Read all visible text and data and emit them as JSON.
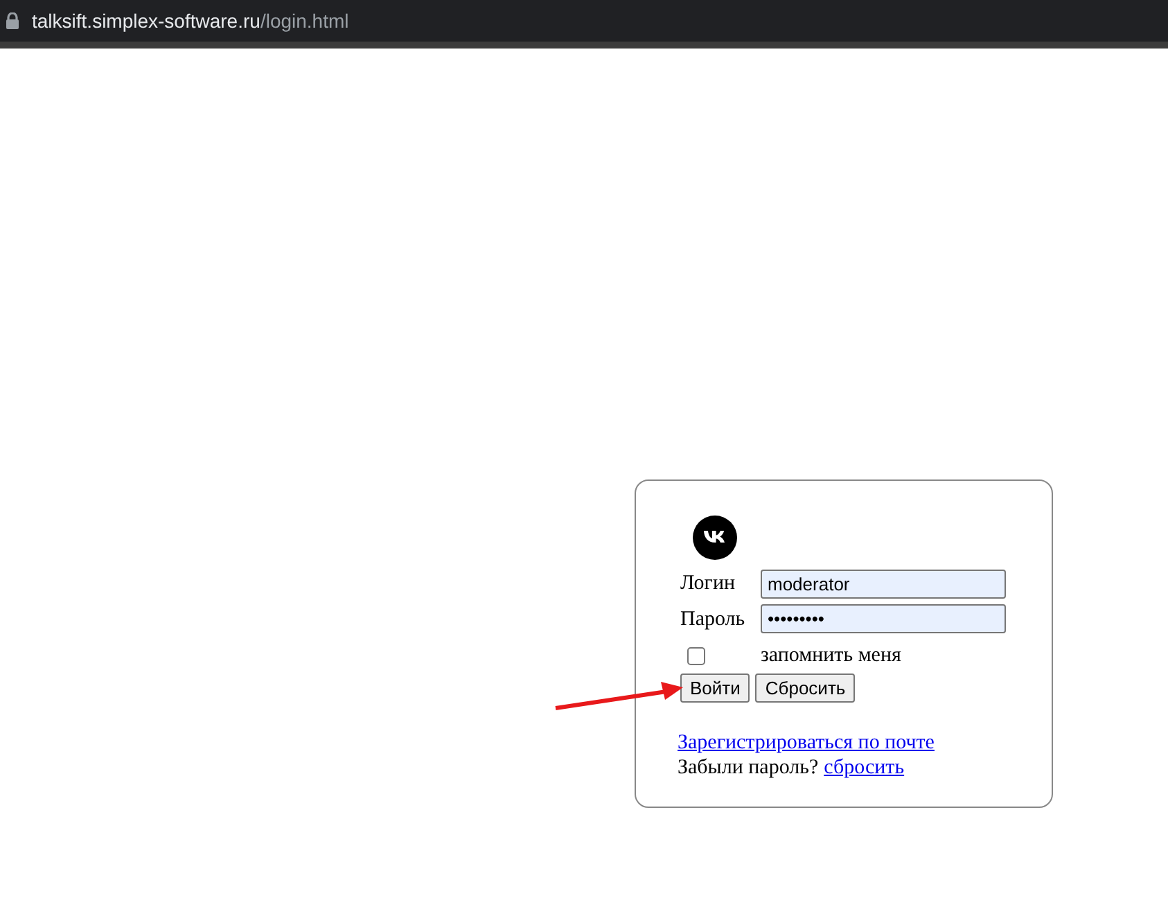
{
  "address_bar": {
    "host": "talksift.simplex-software.ru",
    "path": "/login.html"
  },
  "login_form": {
    "login": {
      "label": "Логин",
      "value": "moderator"
    },
    "password": {
      "label": "Пароль",
      "value": "•••••••••"
    },
    "remember": {
      "label": "запомнить меня",
      "checked": false
    },
    "buttons": [
      {
        "label": "Войти"
      },
      {
        "label": "Сбросить"
      }
    ],
    "register_link": "Зарегистрироваться по почте",
    "forgot_text": "Забыли пароль?",
    "forgot_link": "сбросить"
  },
  "annotations": [
    {
      "kind": "arrow"
    }
  ]
}
